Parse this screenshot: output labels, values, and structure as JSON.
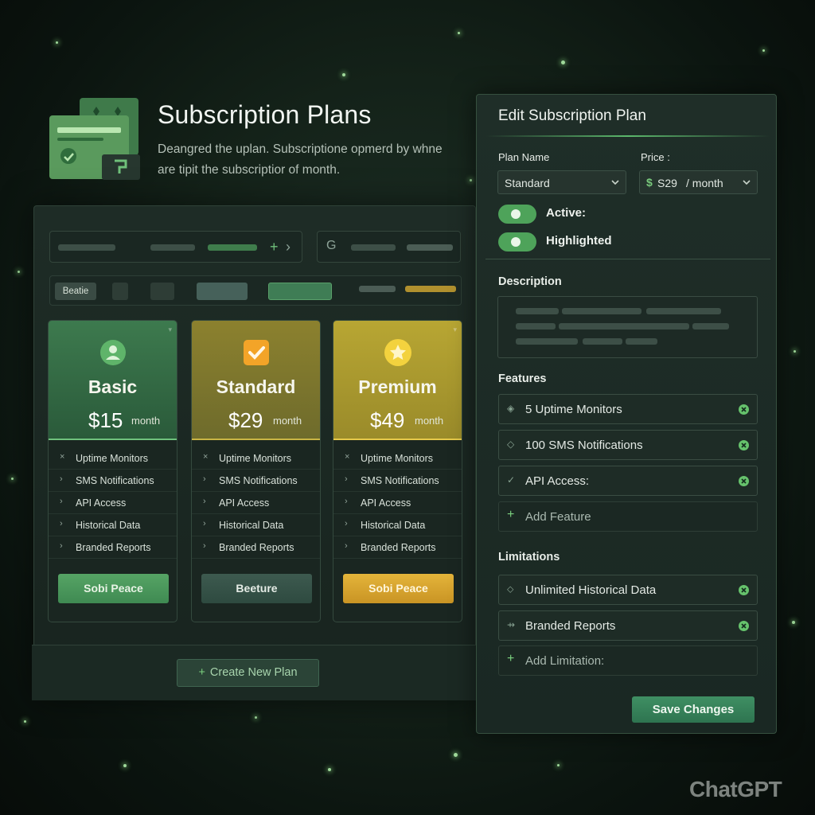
{
  "header": {
    "title": "Subscription Plans",
    "subtitle": "Deangred the uplan. Subscriptione opmerd by whne are tipit the subscriptior of month."
  },
  "tabs": {
    "selected_label": "Beatie"
  },
  "plans": [
    {
      "name": "Basic",
      "price": "$15",
      "period": "month",
      "button_label": "Sobi Peace",
      "features": [
        {
          "mark": "×",
          "label": "Uptime Monitors"
        },
        {
          "mark": "›",
          "label": "SMS Notifications"
        },
        {
          "mark": "›",
          "label": "API Access"
        },
        {
          "mark": "›",
          "label": "Historical Data"
        },
        {
          "mark": "›",
          "label": "Branded Reports"
        }
      ]
    },
    {
      "name": "Standard",
      "price": "$29",
      "period": "month",
      "button_label": "Beeture",
      "features": [
        {
          "mark": "×",
          "label": "Uptime Monitors"
        },
        {
          "mark": "›",
          "label": "SMS Notifications"
        },
        {
          "mark": "›",
          "label": "API Access"
        },
        {
          "mark": "›",
          "label": "Historical Data"
        },
        {
          "mark": "›",
          "label": "Branded Reports"
        }
      ]
    },
    {
      "name": "Premium",
      "price": "$49",
      "period": "month",
      "button_label": "Sobi Peace",
      "features": [
        {
          "mark": "×",
          "label": "Uptime Monitors"
        },
        {
          "mark": "›",
          "label": "SMS Notifications"
        },
        {
          "mark": "›",
          "label": "API Access"
        },
        {
          "mark": "›",
          "label": "Historical Data"
        },
        {
          "mark": "›",
          "label": "Branded Reports"
        }
      ]
    }
  ],
  "create_button": {
    "plus": "+",
    "label": "Create New Plan"
  },
  "edit_panel": {
    "title": "Edit Subscription Plan",
    "plan_name_label": "Plan Name",
    "plan_name_value": "Standard",
    "price_label": "Price :",
    "price_currency": "$",
    "price_value": "S29",
    "price_period": "/ month",
    "active_label": "Active:",
    "active_on": true,
    "highlighted_label": "Highlighted",
    "highlighted_on": true,
    "description_label": "Description",
    "features_label": "Features",
    "features": [
      "5 Uptime Monitors",
      "100 SMS Notifications",
      "API Access:"
    ],
    "add_feature_label": "Add Feature",
    "limitations_label": "Limitations",
    "limitations": [
      "Unlimited Historical Data",
      "Branded Reports"
    ],
    "add_limitation_label": "Add Limitation:",
    "save_label": "Save Changes"
  },
  "watermark": "ChatGPT",
  "colors": {
    "accent_green": "#4ea35a",
    "gold": "#e4b43a",
    "panel_bg": "#1f2e28"
  }
}
